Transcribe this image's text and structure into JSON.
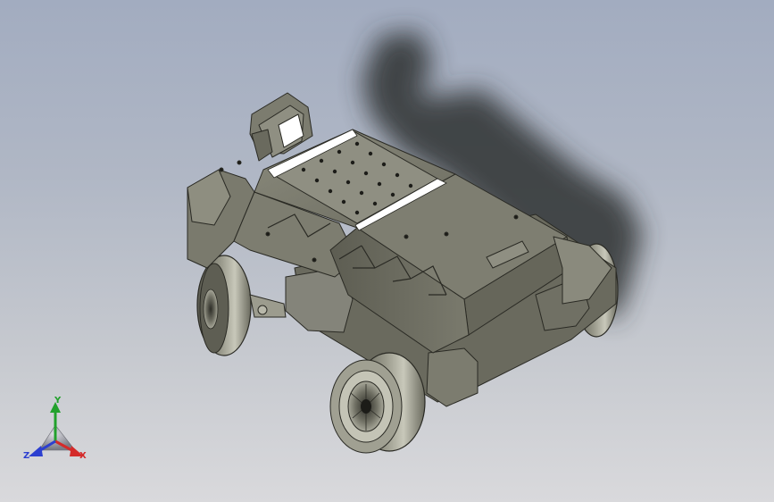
{
  "viewport": {
    "background_top": "#a2acc0",
    "background_bottom": "#d9d9dc",
    "model_color": "#77776a",
    "shadow_color": "#2e3033"
  },
  "triad": {
    "x_label": "X",
    "y_label": "Y",
    "z_label": "Z",
    "x_color": "#d42a2a",
    "y_color": "#22a12c",
    "z_color": "#2c3fd0"
  }
}
